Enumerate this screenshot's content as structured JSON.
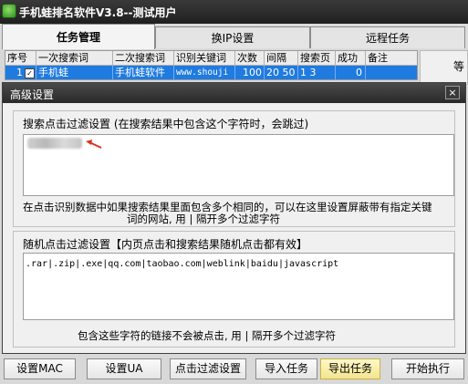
{
  "window": {
    "title": "手机蛙排名软件V3.8--测试用户"
  },
  "tabs": [
    {
      "label": "任务管理"
    },
    {
      "label": "换IP设置"
    },
    {
      "label": "远程任务"
    }
  ],
  "grid": {
    "headers": [
      "序号",
      "一次搜索词",
      "二次搜索词",
      "识别关键词",
      "次数",
      "间隔",
      "搜索页",
      "成功",
      "备注"
    ],
    "row": {
      "index": "1",
      "check": "✓",
      "first_keyword": "手机蛙",
      "second_keyword": "手机蛙软件",
      "recognize": "www.shouji",
      "times": "100",
      "interval": "20 50",
      "search_page": "1 3",
      "success": "0",
      "note": ""
    }
  },
  "right_fragment": {
    "label": "等"
  },
  "dialog": {
    "title": "高级设置",
    "close": "×",
    "search_filter": {
      "label": "搜索点击过滤设置 (在搜索结果中包含这个字符时，会跳过)",
      "value": "",
      "hint_line1": "在点击识别数据中如果搜索结果里面包含多个相同的，可以在这里设置屏蔽带有指定关键",
      "hint_line2": "词的网站, 用 | 隔开多个过滤字符"
    },
    "random_filter": {
      "label": "随机点击过滤设置【内页点击和搜索结果随机点击都有效】",
      "value": ".rar|.zip|.exe|qq.com|taobao.com|weblink|baidu|javascript",
      "hint": "包含这些字符的链接不会被点击, 用 | 隔开多个过滤字符"
    }
  },
  "buttons": [
    {
      "label": "设置MAC"
    },
    {
      "label": "设置UA"
    },
    {
      "label": "点击过滤设置"
    },
    {
      "label": "导入任务"
    },
    {
      "label": "导出任务"
    },
    {
      "label": "开始执行"
    }
  ],
  "colors": {
    "selected_row": "#1f7be0",
    "highlight_button": "#f3e58e",
    "arrow": "#e03020"
  }
}
